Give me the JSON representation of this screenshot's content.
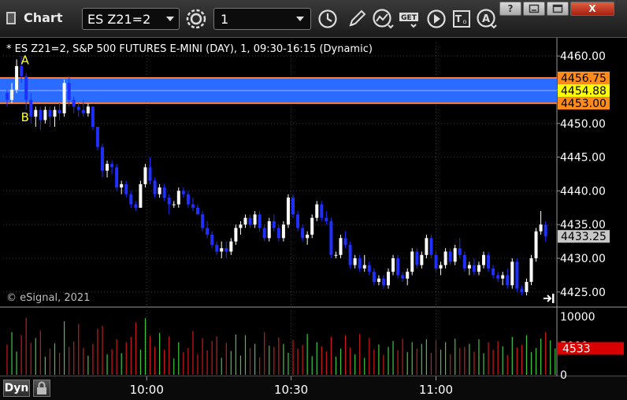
{
  "toolbar": {
    "title": "Chart",
    "symbol": "ES Z21=2",
    "interval": "1",
    "icons": [
      "settings-icon",
      "clock-icon",
      "pencil-icon",
      "indicator-icon",
      "get-icon",
      "play-icon",
      "text-icon",
      "alert-icon"
    ],
    "window_buttons": {
      "help": "?",
      "restore": "",
      "maximize": "",
      "close": "X"
    }
  },
  "chart": {
    "title": "* ES Z21=2, S&P 500 FUTURES E-MINI (DAY), 1, 09:30-16:15 (Dynamic)",
    "copyright": "© eSignal, 2021",
    "mode_label": "Dyn",
    "annotations": [
      {
        "label": "A",
        "time": 0.6,
        "price": 4458.8
      },
      {
        "label": "B",
        "time": 0.6,
        "price": 4450.3
      }
    ],
    "band": {
      "upper": "4456.75",
      "middle": "4454.88",
      "lower": "4453.00"
    },
    "last_price": "4433.25",
    "last_volume": "4533",
    "colors": {
      "band_fill": "#2a6cff",
      "band_edge": "#ff7a2a",
      "candle_down": "#1f2fff",
      "candle_up": "#ffffff",
      "vol_up": "#3ec83e",
      "vol_down": "#d01818",
      "last_price_bg": "#c8c8c8",
      "last_volume_bg": "#d80000",
      "tag_orange": "#ff8c1a",
      "tag_yellow": "#ffff00"
    }
  },
  "chart_data": {
    "type": "candlestick",
    "price_axis": {
      "ticks": [
        "4460.00",
        "4455.00",
        "4450.00",
        "4445.00",
        "4440.00",
        "4435.00",
        "4430.00",
        "4425.00"
      ],
      "ylim": [
        4423.0,
        4462.0
      ]
    },
    "volume_axis": {
      "ticks": [
        "10000",
        "5000",
        "0"
      ],
      "ylim": [
        0,
        10000
      ]
    },
    "time_axis": {
      "ticks": [
        {
          "label": "10:00",
          "bar": 29.3
        },
        {
          "label": "10:30",
          "bar": 59.6
        },
        {
          "label": "11:00",
          "bar": 90.0
        }
      ]
    },
    "bars": [
      [
        4454.5,
        4455.0,
        4452.5,
        4453.5
      ],
      [
        4453.5,
        4456.0,
        4453.0,
        4455.0
      ],
      [
        4455.0,
        4459.5,
        4454.5,
        4458.5
      ],
      [
        4458.5,
        4460.0,
        4456.0,
        4457.0
      ],
      [
        4457.0,
        4457.5,
        4452.0,
        4453.5
      ],
      [
        4453.5,
        4454.5,
        4450.0,
        4451.0
      ],
      [
        4451.0,
        4452.5,
        4449.5,
        4452.0
      ],
      [
        4452.0,
        4452.5,
        4449.0,
        4450.5
      ],
      [
        4450.5,
        4452.5,
        4450.0,
        4452.0
      ],
      [
        4452.0,
        4452.5,
        4449.5,
        4451.0
      ],
      [
        4451.0,
        4452.5,
        4449.5,
        4452.0
      ],
      [
        4452.0,
        4453.0,
        4450.5,
        4451.5
      ],
      [
        4451.5,
        4456.5,
        4451.0,
        4456.0
      ],
      [
        4456.0,
        4457.0,
        4452.5,
        4453.5
      ],
      [
        4453.5,
        4454.0,
        4451.5,
        4452.5
      ],
      [
        4452.5,
        4453.0,
        4451.0,
        4452.0
      ],
      [
        4452.0,
        4453.5,
        4451.0,
        4451.5
      ],
      [
        4451.5,
        4453.0,
        4451.0,
        4452.5
      ],
      [
        4452.5,
        4452.5,
        4449.0,
        4449.5
      ],
      [
        4449.5,
        4449.5,
        4446.0,
        4446.5
      ],
      [
        4446.5,
        4447.0,
        4442.0,
        4443.0
      ],
      [
        4443.0,
        4444.5,
        4442.0,
        4444.0
      ],
      [
        4444.0,
        4444.5,
        4442.5,
        4443.5
      ],
      [
        4443.5,
        4444.0,
        4440.0,
        4440.5
      ],
      [
        4440.5,
        4441.5,
        4439.5,
        4441.0
      ],
      [
        4441.0,
        4441.5,
        4439.0,
        4439.5
      ],
      [
        4439.5,
        4440.0,
        4437.5,
        4438.0
      ],
      [
        4438.0,
        4438.5,
        4437.0,
        4437.5
      ],
      [
        4437.5,
        4441.5,
        4437.5,
        4441.0
      ],
      [
        4441.0,
        4444.0,
        4440.5,
        4443.5
      ],
      [
        4443.5,
        4445.0,
        4441.0,
        4441.5
      ],
      [
        4441.5,
        4442.0,
        4439.0,
        4439.5
      ],
      [
        4439.5,
        4441.0,
        4439.0,
        4440.5
      ],
      [
        4440.5,
        4441.0,
        4438.5,
        4439.0
      ],
      [
        4439.0,
        4439.5,
        4436.5,
        4438.0
      ],
      [
        4438.0,
        4438.5,
        4437.5,
        4438.0
      ],
      [
        4438.0,
        4440.5,
        4437.5,
        4440.0
      ],
      [
        4440.0,
        4440.5,
        4439.0,
        4439.5
      ],
      [
        4439.5,
        4440.0,
        4437.5,
        4438.0
      ],
      [
        4438.0,
        4439.0,
        4437.0,
        4437.5
      ],
      [
        4437.5,
        4438.0,
        4436.5,
        4436.5
      ],
      [
        4436.5,
        4437.0,
        4434.0,
        4434.5
      ],
      [
        4434.5,
        4435.5,
        4433.0,
        4433.5
      ],
      [
        4433.5,
        4434.0,
        4431.5,
        4432.0
      ],
      [
        4432.0,
        4432.5,
        4430.5,
        4431.0
      ],
      [
        4431.0,
        4432.5,
        4430.0,
        4431.5
      ],
      [
        4431.5,
        4432.5,
        4430.0,
        4431.0
      ],
      [
        4431.0,
        4433.0,
        4430.5,
        4432.5
      ],
      [
        4432.5,
        4435.0,
        4432.0,
        4434.5
      ],
      [
        4434.5,
        4435.5,
        4433.5,
        4435.0
      ],
      [
        4435.0,
        4436.5,
        4434.5,
        4436.0
      ],
      [
        4436.0,
        4436.5,
        4434.5,
        4435.0
      ],
      [
        4435.0,
        4437.0,
        4434.5,
        4436.5
      ],
      [
        4436.5,
        4437.0,
        4434.0,
        4434.5
      ],
      [
        4434.5,
        4435.0,
        4432.5,
        4433.0
      ],
      [
        4433.0,
        4436.0,
        4432.5,
        4435.5
      ],
      [
        4435.5,
        4436.5,
        4434.0,
        4434.5
      ],
      [
        4434.5,
        4435.0,
        4432.5,
        4433.0
      ],
      [
        4433.0,
        4435.5,
        4432.5,
        4435.0
      ],
      [
        4435.0,
        4439.5,
        4434.5,
        4439.0
      ],
      [
        4439.0,
        4439.5,
        4436.0,
        4436.5
      ],
      [
        4436.5,
        4437.0,
        4434.0,
        4434.5
      ],
      [
        4434.5,
        4435.0,
        4432.5,
        4433.0
      ],
      [
        4433.0,
        4434.0,
        4432.0,
        4433.5
      ],
      [
        4433.5,
        4436.5,
        4433.0,
        4436.0
      ],
      [
        4436.0,
        4438.5,
        4435.5,
        4438.0
      ],
      [
        4438.0,
        4438.5,
        4435.5,
        4436.0
      ],
      [
        4436.0,
        4437.0,
        4435.0,
        4435.5
      ],
      [
        4435.5,
        4436.0,
        4430.0,
        4430.5
      ],
      [
        4430.5,
        4431.0,
        4430.0,
        4430.5
      ],
      [
        4430.5,
        4433.5,
        4430.0,
        4433.0
      ],
      [
        4433.0,
        4434.0,
        4431.5,
        4432.0
      ],
      [
        4432.0,
        4432.5,
        4428.5,
        4429.0
      ],
      [
        4429.0,
        4430.5,
        4428.5,
        4430.0
      ],
      [
        4430.0,
        4430.5,
        4428.0,
        4428.5
      ],
      [
        4428.5,
        4430.5,
        4428.0,
        4429.0
      ],
      [
        4429.0,
        4429.5,
        4427.5,
        4428.0
      ],
      [
        4428.0,
        4428.5,
        4426.0,
        4426.5
      ],
      [
        4426.5,
        4427.5,
        4426.0,
        4427.0
      ],
      [
        4427.0,
        4427.5,
        4425.5,
        4426.0
      ],
      [
        4426.0,
        4428.5,
        4425.5,
        4428.0
      ],
      [
        4428.0,
        4430.5,
        4427.5,
        4430.0
      ],
      [
        4430.0,
        4430.5,
        4427.0,
        4427.5
      ],
      [
        4427.5,
        4428.0,
        4426.5,
        4427.0
      ],
      [
        4427.0,
        4428.5,
        4426.0,
        4428.0
      ],
      [
        4428.0,
        4431.5,
        4427.5,
        4431.0
      ],
      [
        4431.0,
        4431.5,
        4428.5,
        4429.0
      ],
      [
        4429.0,
        4431.0,
        4428.5,
        4430.5
      ],
      [
        4430.5,
        4433.5,
        4430.0,
        4433.0
      ],
      [
        4433.0,
        4433.5,
        4430.0,
        4430.5
      ],
      [
        4430.5,
        4431.0,
        4428.0,
        4428.5
      ],
      [
        4428.5,
        4429.5,
        4427.5,
        4429.0
      ],
      [
        4429.0,
        4431.5,
        4428.5,
        4431.0
      ],
      [
        4431.0,
        4431.5,
        4429.0,
        4429.5
      ],
      [
        4429.5,
        4432.0,
        4429.0,
        4431.5
      ],
      [
        4431.5,
        4433.0,
        4430.0,
        4430.5
      ],
      [
        4430.5,
        4431.0,
        4428.0,
        4428.5
      ],
      [
        4428.5,
        4429.5,
        4427.5,
        4429.0
      ],
      [
        4429.0,
        4430.0,
        4427.5,
        4428.0
      ],
      [
        4428.0,
        4429.5,
        4427.5,
        4429.0
      ],
      [
        4429.0,
        4431.0,
        4428.5,
        4430.5
      ],
      [
        4430.5,
        4431.0,
        4428.0,
        4428.5
      ],
      [
        4428.5,
        4429.0,
        4427.0,
        4427.5
      ],
      [
        4427.5,
        4428.0,
        4426.5,
        4427.0
      ],
      [
        4427.0,
        4428.0,
        4426.0,
        4427.5
      ],
      [
        4427.5,
        4428.5,
        4425.5,
        4426.0
      ],
      [
        4426.0,
        4430.0,
        4425.5,
        4429.5
      ],
      [
        4429.5,
        4430.0,
        4425.0,
        4425.5
      ],
      [
        4425.5,
        4426.0,
        4424.5,
        4425.0
      ],
      [
        4425.0,
        4427.0,
        4424.5,
        4426.5
      ],
      [
        4426.5,
        4430.5,
        4426.0,
        4430.0
      ],
      [
        4430.0,
        4434.5,
        4429.5,
        4434.0
      ],
      [
        4434.0,
        4437.0,
        4433.5,
        4435.0
      ],
      [
        4435.0,
        4435.5,
        4432.5,
        4433.25
      ]
    ],
    "volumes": [
      5200,
      7300,
      4000,
      6800,
      9800,
      5500,
      6300,
      7600,
      3100,
      4500,
      5400,
      3800,
      9200,
      4800,
      5700,
      8700,
      4600,
      3300,
      5300,
      7900,
      8400,
      3500,
      4400,
      6100,
      3700,
      5600,
      6500,
      9000,
      4300,
      9700,
      6700,
      4800,
      7200,
      4300,
      6600,
      2800,
      5600,
      3900,
      4600,
      7500,
      3500,
      6300,
      4200,
      5800,
      6600,
      2900,
      5500,
      4100,
      6900,
      3300,
      6800,
      4600,
      5300,
      3000,
      7300,
      5000,
      4800,
      6400,
      5300,
      3800,
      6000,
      4500,
      5100,
      7000,
      3200,
      5600,
      4900,
      4000,
      6500,
      3100,
      4500,
      6800,
      4700,
      3500,
      7000,
      2900,
      6300,
      4300,
      5200,
      3400,
      4800,
      5800,
      4200,
      6200,
      3900,
      5600,
      4500,
      5300,
      6100,
      3800,
      5900,
      4300,
      5600,
      3500,
      6200,
      4600,
      4800,
      5300,
      4000,
      6100,
      3700,
      5600,
      4300,
      5800,
      4900,
      3400,
      6500,
      4700,
      5100,
      6800,
      3900,
      4600,
      6200,
      7300,
      5900,
      4533
    ]
  }
}
